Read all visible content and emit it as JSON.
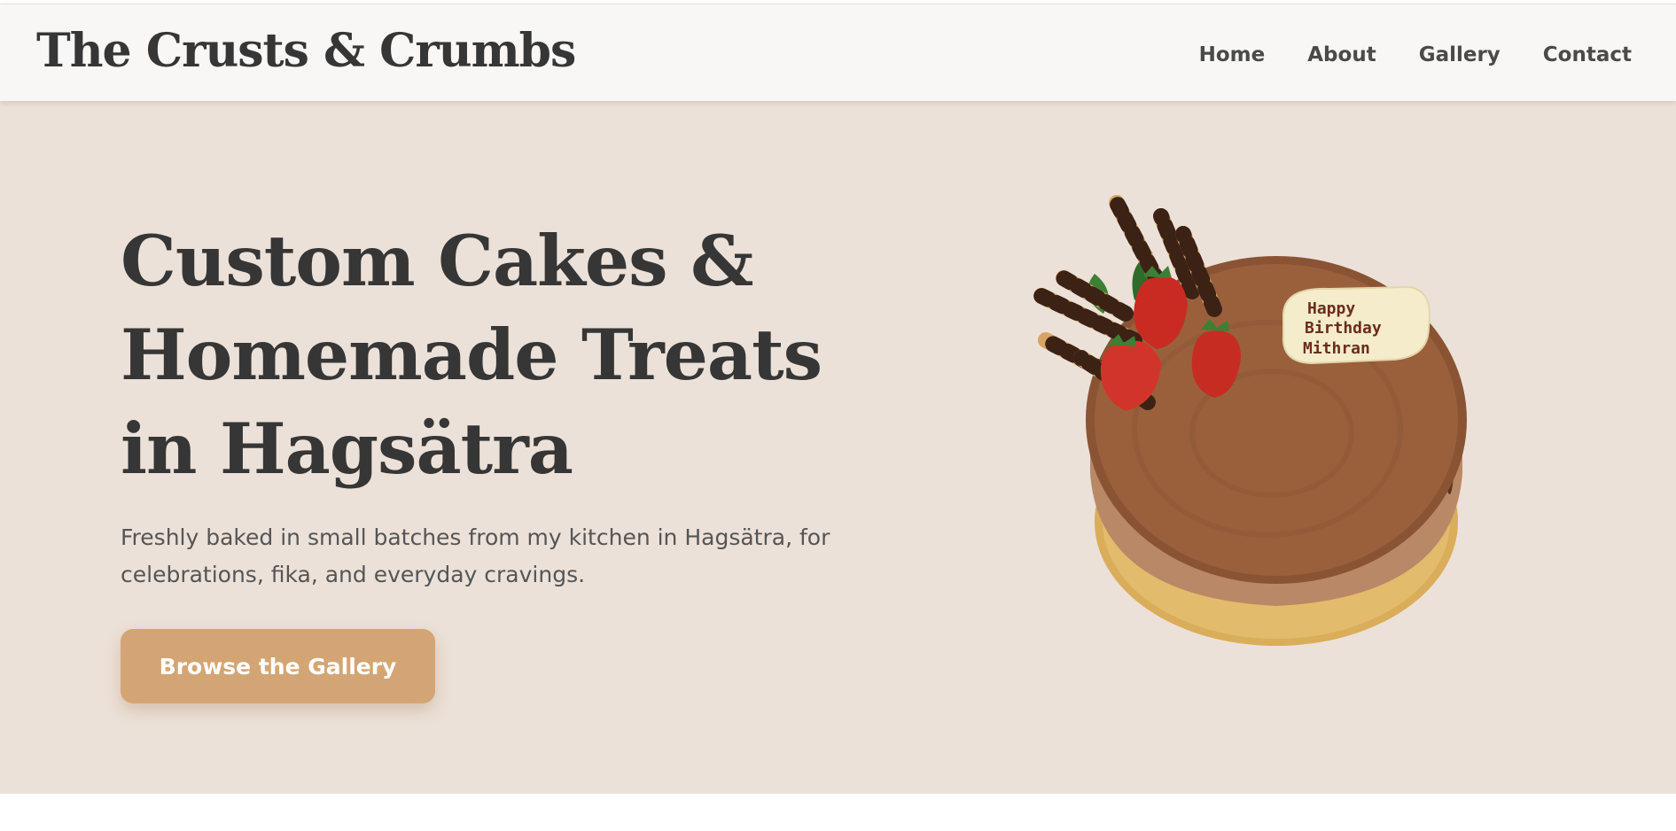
{
  "brand": {
    "name": "The Crusts & Crumbs"
  },
  "nav": {
    "items": [
      {
        "label": "Home"
      },
      {
        "label": "About"
      },
      {
        "label": "Gallery"
      },
      {
        "label": "Contact"
      }
    ]
  },
  "hero": {
    "title": "Custom Cakes & Homemade Treats in Hagsätra",
    "subtitle": "Freshly baked in small batches from my kitchen in Hagsätra, for celebrations, fika, and everyday cravings.",
    "cta_label": "Browse the Gallery",
    "cake_image": {
      "plaque_lines": [
        "Happy",
        "Birthday",
        "Mithran"
      ]
    }
  },
  "colors": {
    "navbar_bg": "#f8f7f6",
    "hero_bg": "#ece1d8",
    "accent": "#d4a574",
    "text_dark": "#363636",
    "text_muted": "#555555"
  }
}
